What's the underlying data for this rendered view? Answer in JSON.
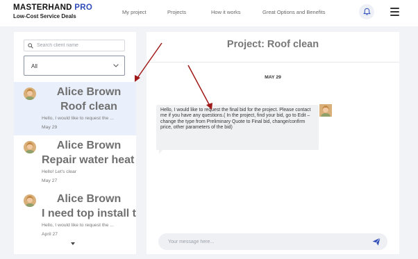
{
  "brand": {
    "name": "MASTERHAND",
    "name_accent": "PRO",
    "tagline": "Low-Cost Service Deals"
  },
  "nav": [
    {
      "label": "My project"
    },
    {
      "label": "Projects"
    },
    {
      "label": "How it works"
    },
    {
      "label": "Great Options and Benefits"
    }
  ],
  "sidebar": {
    "search_placeholder": "Search client name",
    "filter_value": "All",
    "conversations": [
      {
        "name": "Alice Brown",
        "project": "Roof clean",
        "preview": "Hello, I would like to request the ...",
        "date": "May 29",
        "active": true
      },
      {
        "name": "Alice Brown",
        "project": "Repair water heat",
        "preview": "Hello! Let's clear",
        "date": "May 27",
        "active": false
      },
      {
        "name": "Alice Brown",
        "project": "I need top install t",
        "preview": "Hello, I would like to request the ...",
        "date": "April 27",
        "active": false
      }
    ]
  },
  "chat": {
    "title": "Project: Roof clean",
    "day": "MAY 29",
    "message": "Hello, I would like to request the final bid for the project. Please contact me if you have any questions.( In the project, find your bid, go to Edit – change the type from Preliminary Quote to Final bid, change/confirm price, other parameters of the bid)",
    "composer_placeholder": "Your message here..."
  },
  "colors": {
    "brand_accent": "#2f4cb8",
    "active_item": "#eaf0fb",
    "send_icon": "#2f4cb8",
    "annotation_arrow": "#a01818"
  }
}
